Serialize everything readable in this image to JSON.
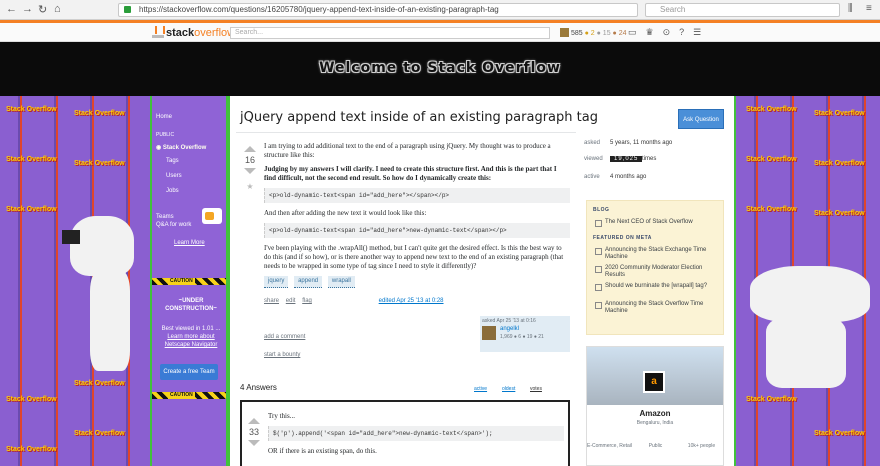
{
  "browser": {
    "url": "https://stackoverflow.com/questions/16205780/jquery-append-text-inside-of-an-existing-paragraph-tag",
    "search_placeholder": "Search"
  },
  "topbar": {
    "logo_stack": "stack",
    "logo_overflow": "overflow",
    "search_placeholder": "Search...",
    "reputation": "585",
    "badges_gold": "● 2",
    "badges_silver": "● 15",
    "badges_bronze": "● 24"
  },
  "banner": {
    "title": "Welcome to Stack Overflow"
  },
  "tile_text": "Stack Overflow",
  "leftnav": {
    "home": "Home",
    "public": "PUBLIC",
    "stack_overflow": "Stack Overflow",
    "tags": "Tags",
    "users": "Users",
    "jobs": "Jobs",
    "teams_title": "Teams",
    "teams_sub": "Q&A for work",
    "learn_more": "Learn More",
    "caution": "CAUTION",
    "uc_title": "~UNDER",
    "uc_title2": "CONSTRUCTION~",
    "uc_text": "Best viewed in 1.01 ...",
    "uc_link": "Learn more about",
    "uc_link2": "Netscape Navigator",
    "teams_btn": "Create a free Team"
  },
  "question": {
    "title": "jQuery append text inside of an existing paragraph tag",
    "ask_button": "Ask Question",
    "votes": "16",
    "p1": "I am trying to add additional text to the end of a paragraph using jQuery. My thought was to produce a structure like this:",
    "p2": "Judging by my answers I will clarify. I need to create this structure first. And this is the part that I find difficult, not the second end result. So how do I dynamically create this:",
    "code1": "<p>old-dynamic-text<span id=\"add_here\"></span></p>",
    "p3": "And then after adding the new text it would look like this:",
    "code2": "<p>old-dynamic-text<span id=\"add_here\">new-dynamic-text</span></p>",
    "p4": "I've been playing with the .wrapAll() method, but I can't quite get the desired effect. Is this the best way to do this (and if so how), or is there another way to append new text to the end of an existing paragraph (that needs to be wrapped in some type of tag since I need to style it differently)?",
    "tags": [
      "jquery",
      "append",
      "wrapall"
    ],
    "share": "share",
    "edit": "edit",
    "flag": "flag",
    "edited": "edited Apr 25 '13 at 0:28",
    "asked": "asked Apr 25 '13 at 0:16",
    "asker": "angelkl",
    "asker_rep": "1,969 ● 6 ● 19 ● 21",
    "add_comment": "add a comment",
    "start_bounty": "start a bounty"
  },
  "meta": {
    "asked_label": "asked",
    "asked_value": "5 years, 11 months ago",
    "viewed_label": "viewed",
    "viewed_value": "19,025",
    "viewed_suffix": "times",
    "active_label": "active",
    "active_value": "4 months ago"
  },
  "blog": {
    "h1": "BLOG",
    "items1": [
      "The Next CEO of Stack Overflow"
    ],
    "h2": "FEATURED ON META",
    "items2": [
      "Announcing the Stack Exchange Time Machine",
      "2020 Community Moderator Election Results",
      "Should we burninate the [wrapall] tag?",
      "Announcing the Stack Overflow Time Machine"
    ]
  },
  "ad": {
    "company": "Amazon",
    "location": "Bengaluru, India",
    "f1": "E-Commerce, Retail",
    "f2": "Public",
    "f3": "10k+ people"
  },
  "answers": {
    "count": "4 Answers",
    "sort_active": "active",
    "sort_oldest": "oldest",
    "sort_votes": "votes",
    "a1_votes": "33",
    "a1_text": "Try this...",
    "a1_code": "$('p').append('<span id=\"add_here\">new-dynamic-text</span>');",
    "a1_more": "OR if there is an existing span, do this."
  }
}
